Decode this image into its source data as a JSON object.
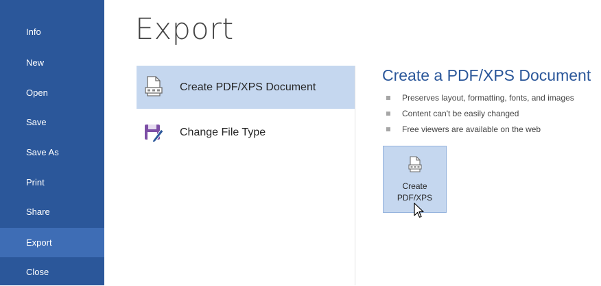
{
  "sidebar": {
    "items": [
      {
        "label": "Info"
      },
      {
        "label": "New"
      },
      {
        "label": "Open"
      },
      {
        "label": "Save"
      },
      {
        "label": "Save As"
      },
      {
        "label": "Print"
      },
      {
        "label": "Share"
      },
      {
        "label": "Export",
        "active": true
      },
      {
        "label": "Close"
      }
    ]
  },
  "main": {
    "title": "Export",
    "options": [
      {
        "label": "Create PDF/XPS Document",
        "icon": "pdf-document-icon",
        "selected": true
      },
      {
        "label": "Change File Type",
        "icon": "change-file-type-icon",
        "selected": false
      }
    ]
  },
  "detail": {
    "title": "Create a PDF/XPS Document",
    "bullets": [
      "Preserves layout, formatting, fonts, and images",
      "Content can't be easily changed",
      "Free viewers are available on the web"
    ],
    "button": {
      "line1": "Create",
      "line2": "PDF/XPS",
      "icon": "pdf-document-icon"
    }
  },
  "colors": {
    "sidebar_bg": "#2b579a",
    "sidebar_active": "#3e6db5",
    "selection_bg": "#c5d7ef",
    "accent": "#2b579a"
  }
}
